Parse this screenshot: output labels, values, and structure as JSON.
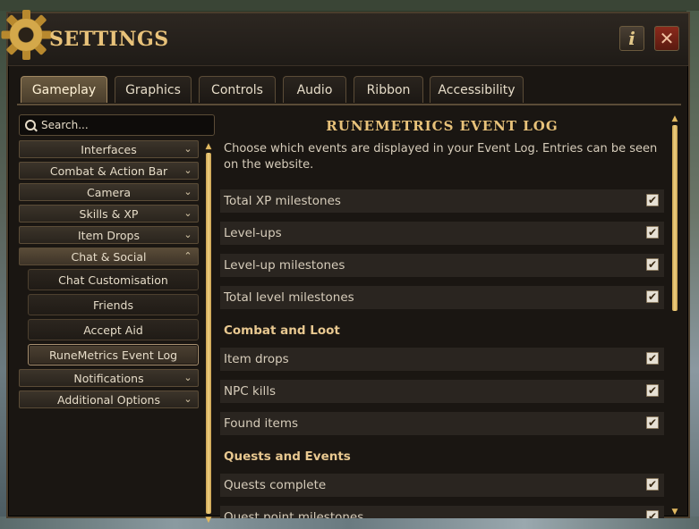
{
  "window": {
    "title": "SETTINGS",
    "info_glyph": "i",
    "close_glyph": "✕"
  },
  "tabs": [
    {
      "label": "Gameplay",
      "active": true
    },
    {
      "label": "Graphics"
    },
    {
      "label": "Controls"
    },
    {
      "label": "Audio"
    },
    {
      "label": "Ribbon"
    },
    {
      "label": "Accessibility"
    }
  ],
  "search": {
    "placeholder": "Search..."
  },
  "nav": {
    "items": [
      {
        "label": "Interfaces",
        "chevron": "⌄"
      },
      {
        "label": "Combat & Action Bar",
        "chevron": "⌄"
      },
      {
        "label": "Camera",
        "chevron": "⌄"
      },
      {
        "label": "Skills & XP",
        "chevron": "⌄"
      },
      {
        "label": "Item Drops",
        "chevron": "⌄"
      },
      {
        "label": "Chat & Social",
        "chevron": "⌃",
        "expanded": true
      },
      {
        "label": "Notifications",
        "chevron": "⌄"
      },
      {
        "label": "Additional Options",
        "chevron": "⌄"
      }
    ],
    "subitems": [
      {
        "label": "Chat Customisation"
      },
      {
        "label": "Friends"
      },
      {
        "label": "Accept Aid"
      },
      {
        "label": "RuneMetrics Event Log",
        "active": true
      }
    ]
  },
  "content": {
    "heading": "RUNEMETRICS EVENT LOG",
    "description": "Choose which events are displayed in your Event Log. Entries can be seen on the website.",
    "options_general": [
      {
        "label": "Total XP milestones",
        "checked": true
      },
      {
        "label": "Level-ups",
        "checked": true
      },
      {
        "label": "Level-up milestones",
        "checked": true
      },
      {
        "label": "Total level milestones",
        "checked": true
      }
    ],
    "section_combat": "Combat and Loot",
    "options_combat": [
      {
        "label": "Item drops",
        "checked": true
      },
      {
        "label": "NPC kills",
        "checked": true
      },
      {
        "label": "Found items",
        "checked": true
      }
    ],
    "section_quests": "Quests and Events",
    "options_quests": [
      {
        "label": "Quests complete",
        "checked": true
      },
      {
        "label": "Quest point milestones",
        "checked": true
      }
    ],
    "checkmark": "✔"
  },
  "colors": {
    "accent_gold": "#e8c27a",
    "panel": "#1a1612",
    "row": "#2a2520"
  }
}
